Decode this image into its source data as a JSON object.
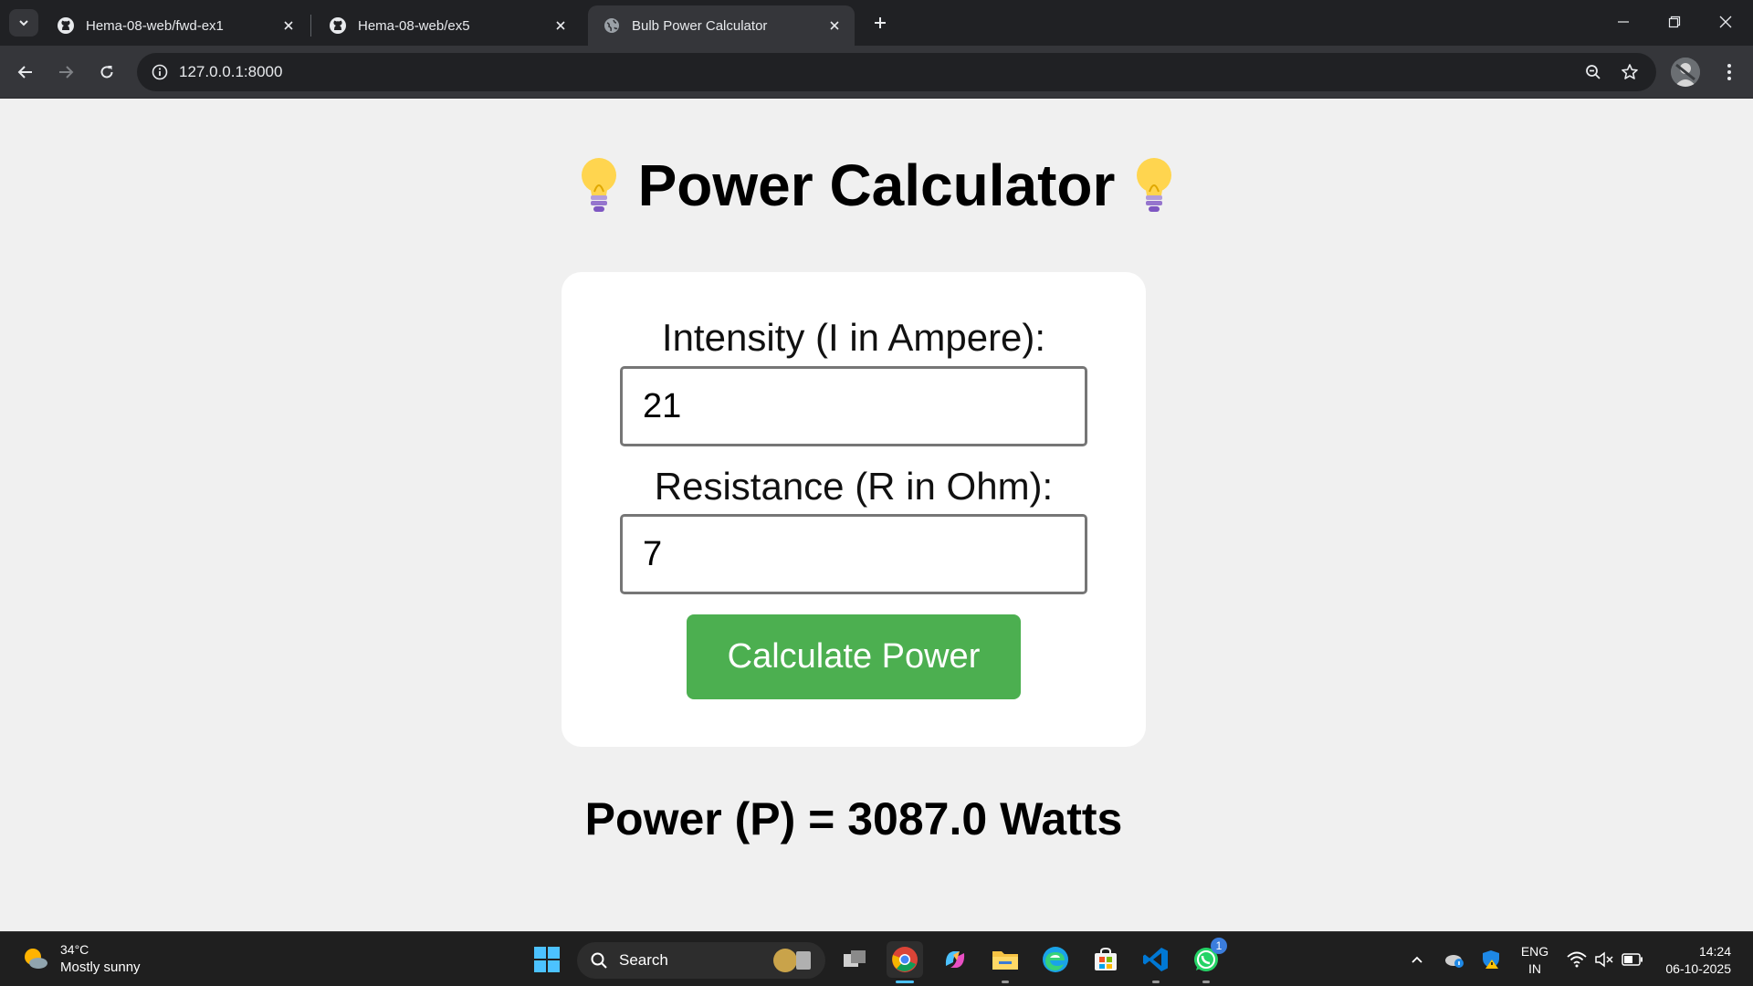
{
  "browser": {
    "tabs": [
      {
        "title": "Hema-08-web/fwd-ex1",
        "favicon": "github-icon",
        "active": false
      },
      {
        "title": "Hema-08-web/ex5",
        "favicon": "github-icon",
        "active": false
      },
      {
        "title": "Bulb Power Calculator",
        "favicon": "globe-icon",
        "active": true
      }
    ],
    "url": "127.0.0.1:8000"
  },
  "page": {
    "heading": "Power Calculator",
    "heading_icon": "lightbulb-icon",
    "intensity_label": "Intensity (I in Ampere):",
    "intensity_value": "21",
    "resistance_label": "Resistance (R in Ohm):",
    "resistance_value": "7",
    "button_label": "Calculate Power",
    "result": "Power (P) = 3087.0 Watts",
    "accent_color": "#4caf50"
  },
  "taskbar": {
    "weather_temp": "34°C",
    "weather_desc": "Mostly sunny",
    "search_label": "Search",
    "whatsapp_badge": "1",
    "lang_line1": "ENG",
    "lang_line2": "IN",
    "time": "14:24",
    "date": "06-10-2025"
  }
}
